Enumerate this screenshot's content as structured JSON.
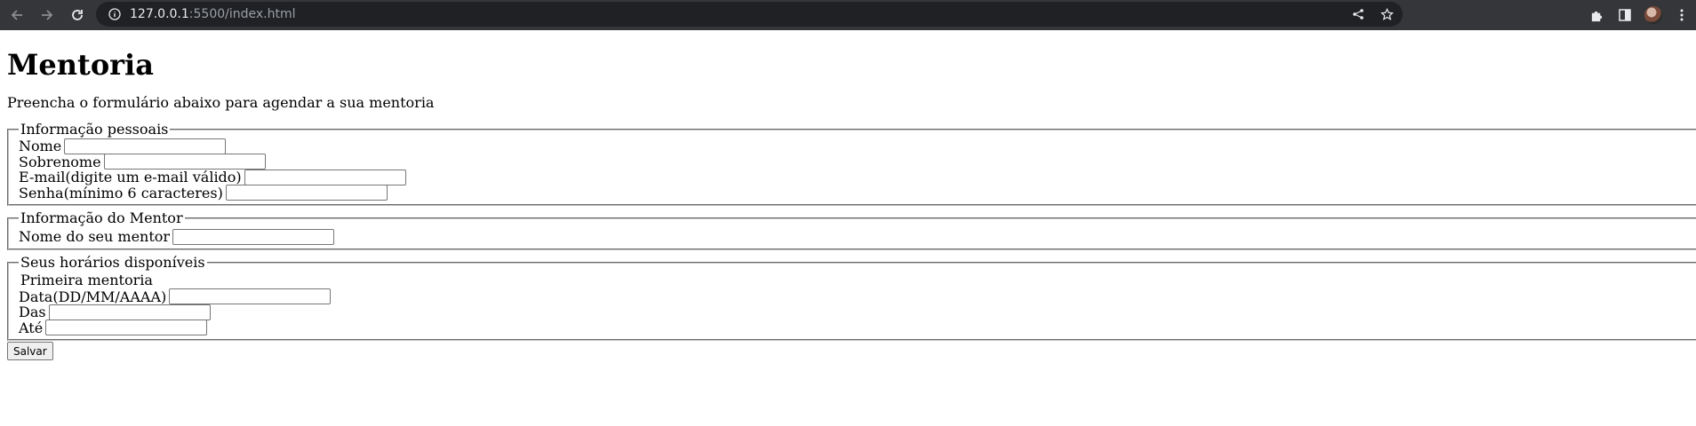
{
  "browser": {
    "url_host": "127.0.0.1",
    "url_rest": ":5500/index.html"
  },
  "page": {
    "title": "Mentoria",
    "intro": "Preencha o formulário abaixo para agendar a sua mentoria",
    "sections": {
      "personal": {
        "legend": "Informação pessoais",
        "nome_label": "Nome",
        "sobrenome_label": "Sobrenome",
        "email_label": "E-mail(digite um e-mail válido)",
        "senha_label": "Senha(mínimo 6 caracteres)"
      },
      "mentor": {
        "legend": "Informação do Mentor",
        "mentor_label": "Nome do seu mentor"
      },
      "schedule": {
        "legend": "Seus horários disponíveis",
        "subtitle": "Primeira mentoria",
        "data_label": "Data(DD/MM/AAAA)",
        "das_label": "Das",
        "ate_label": "Até"
      }
    },
    "save_label": "Salvar"
  }
}
